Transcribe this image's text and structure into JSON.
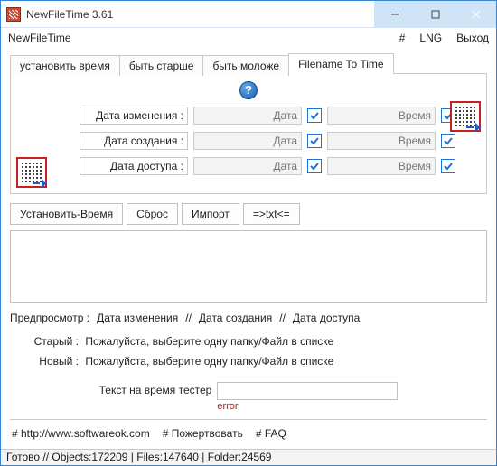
{
  "window": {
    "title": "NewFileTime 3.61"
  },
  "menubar": {
    "left": "NewFileTime",
    "hash": "#",
    "lng": "LNG",
    "exit": "Выход"
  },
  "tabs": {
    "t0": "установить время",
    "t1": "быть старше",
    "t2": "быть моложе",
    "t3": "Filename To Time"
  },
  "form": {
    "mod_label": "Дата изменения :",
    "cre_label": "Дата создания :",
    "acc_label": "Дата доступа :",
    "date_ph": "Дата",
    "time_ph": "Время"
  },
  "buttons": {
    "set": "Установить-Время",
    "reset": "Сброс",
    "import": "Импорт",
    "txt": "=>txt<="
  },
  "preview": {
    "label": "Предпросмотр  :",
    "mod": "Дата изменения",
    "cre": "Дата создания",
    "acc": "Дата доступа",
    "sep": "//"
  },
  "msgs": {
    "old_k": "Старый  :",
    "new_k": "Новый  :",
    "txt": "Пожалуйста, выберите одну папку/Файл в списке"
  },
  "tester": {
    "label": "Текст на время тестер",
    "error": "error"
  },
  "links": {
    "site": "# http://www.softwareok.com",
    "donate": "# Пожертвовать",
    "faq": "# FAQ"
  },
  "status": {
    "text": "Готово // Objects:172209 | Files:147640 | Folder:24569"
  }
}
